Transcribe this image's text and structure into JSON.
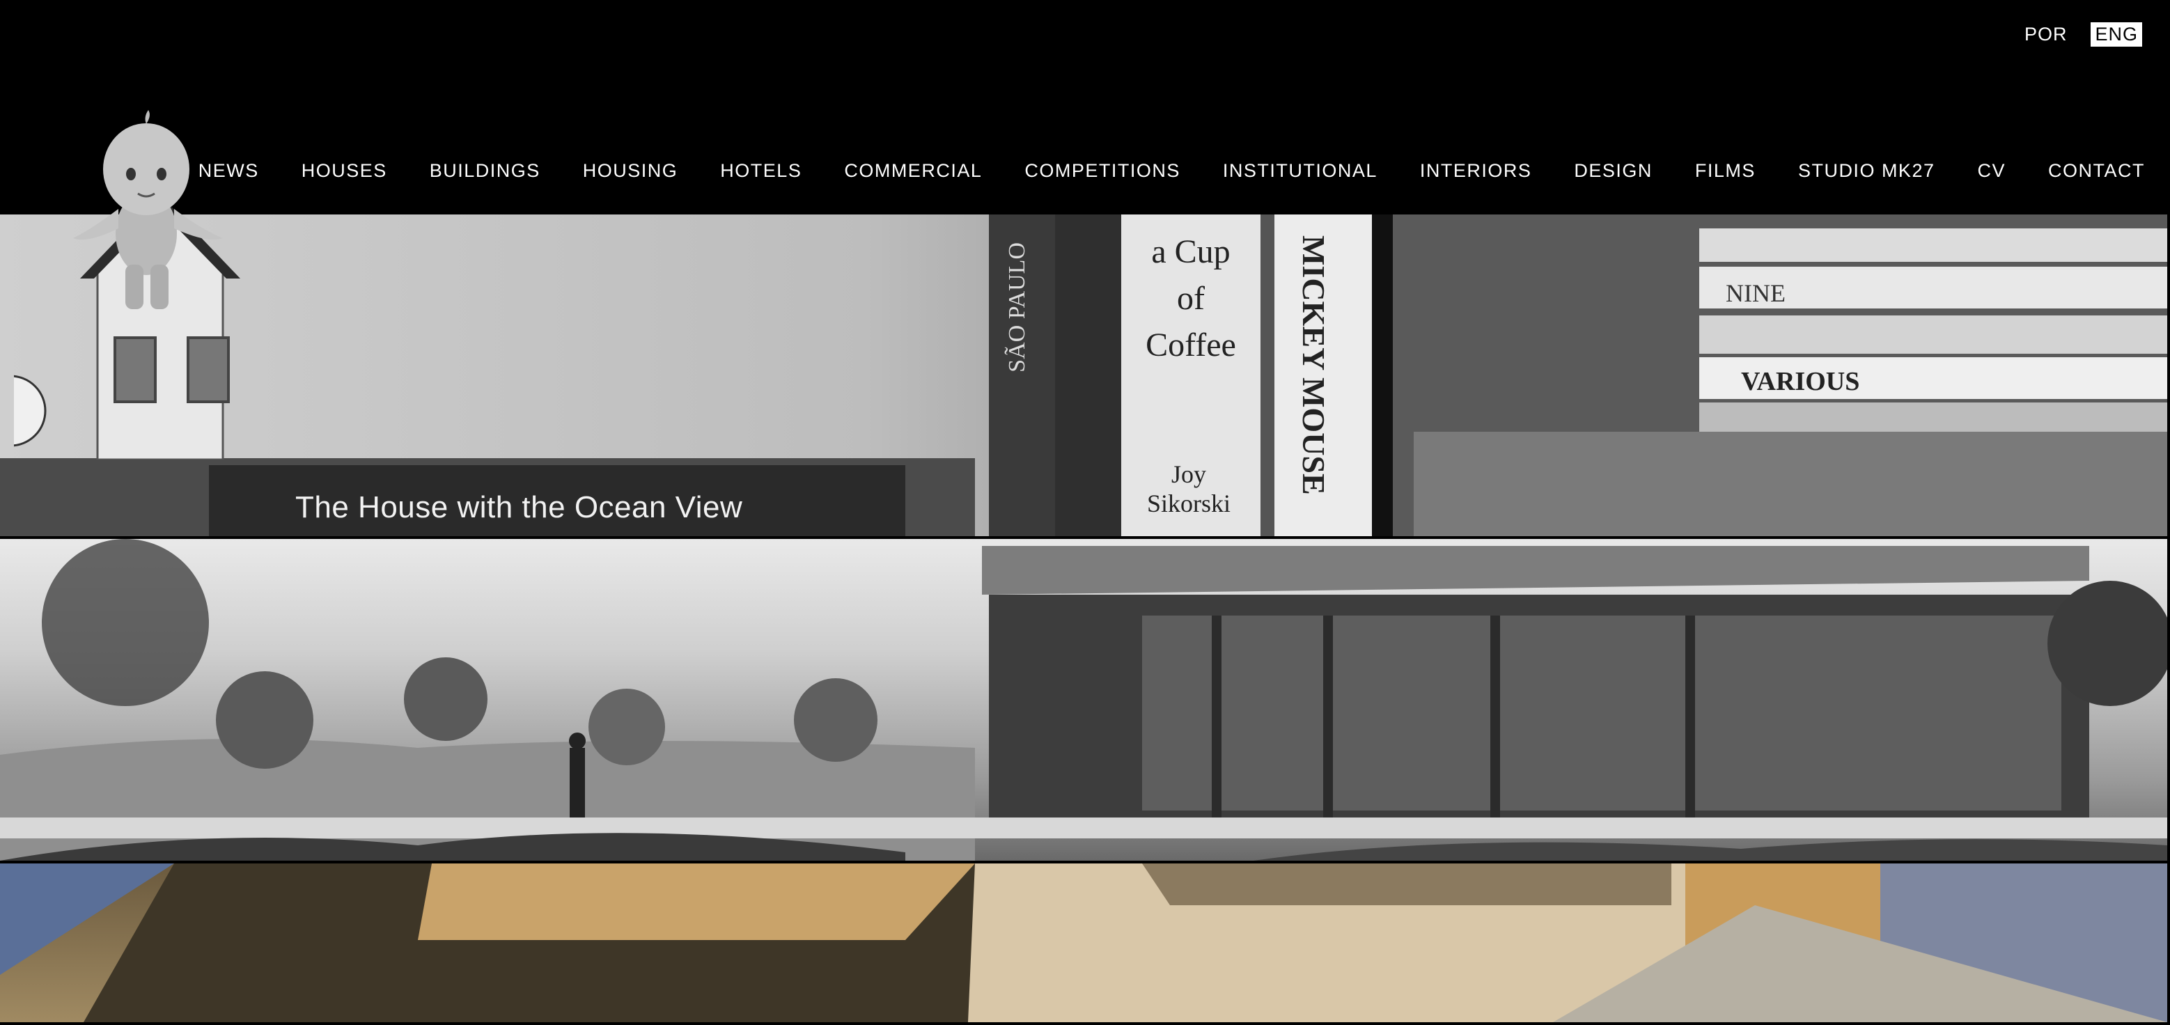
{
  "lang": {
    "por": "POR",
    "eng": "ENG"
  },
  "nav": {
    "news": "NEWS",
    "houses": "HOUSES",
    "buildings": "BUILDINGS",
    "housing": "HOUSING",
    "hotels": "HOTELS",
    "commercial": "COMMERCIAL",
    "competitions": "COMPETITIONS",
    "institutional": "INSTITUTIONAL",
    "interiors": "INTERIORS",
    "design": "DESIGN",
    "films": "FILMS",
    "studio": "STUDIO MK27",
    "cv": "CV",
    "contact": "CONTACT"
  },
  "banner1": {
    "book_title": "The House with the Ocean View",
    "spine_sao_paulo": "SÃO PAULO",
    "spine_cup": "a Cup of Coffee",
    "spine_author": "Joy Sikorski",
    "spine_mickey": "MICKEY MOUSE",
    "book_nine": "NINE",
    "book_various": "VARIOUS"
  },
  "icons": {
    "logo": "kewpie-on-house-logo"
  }
}
